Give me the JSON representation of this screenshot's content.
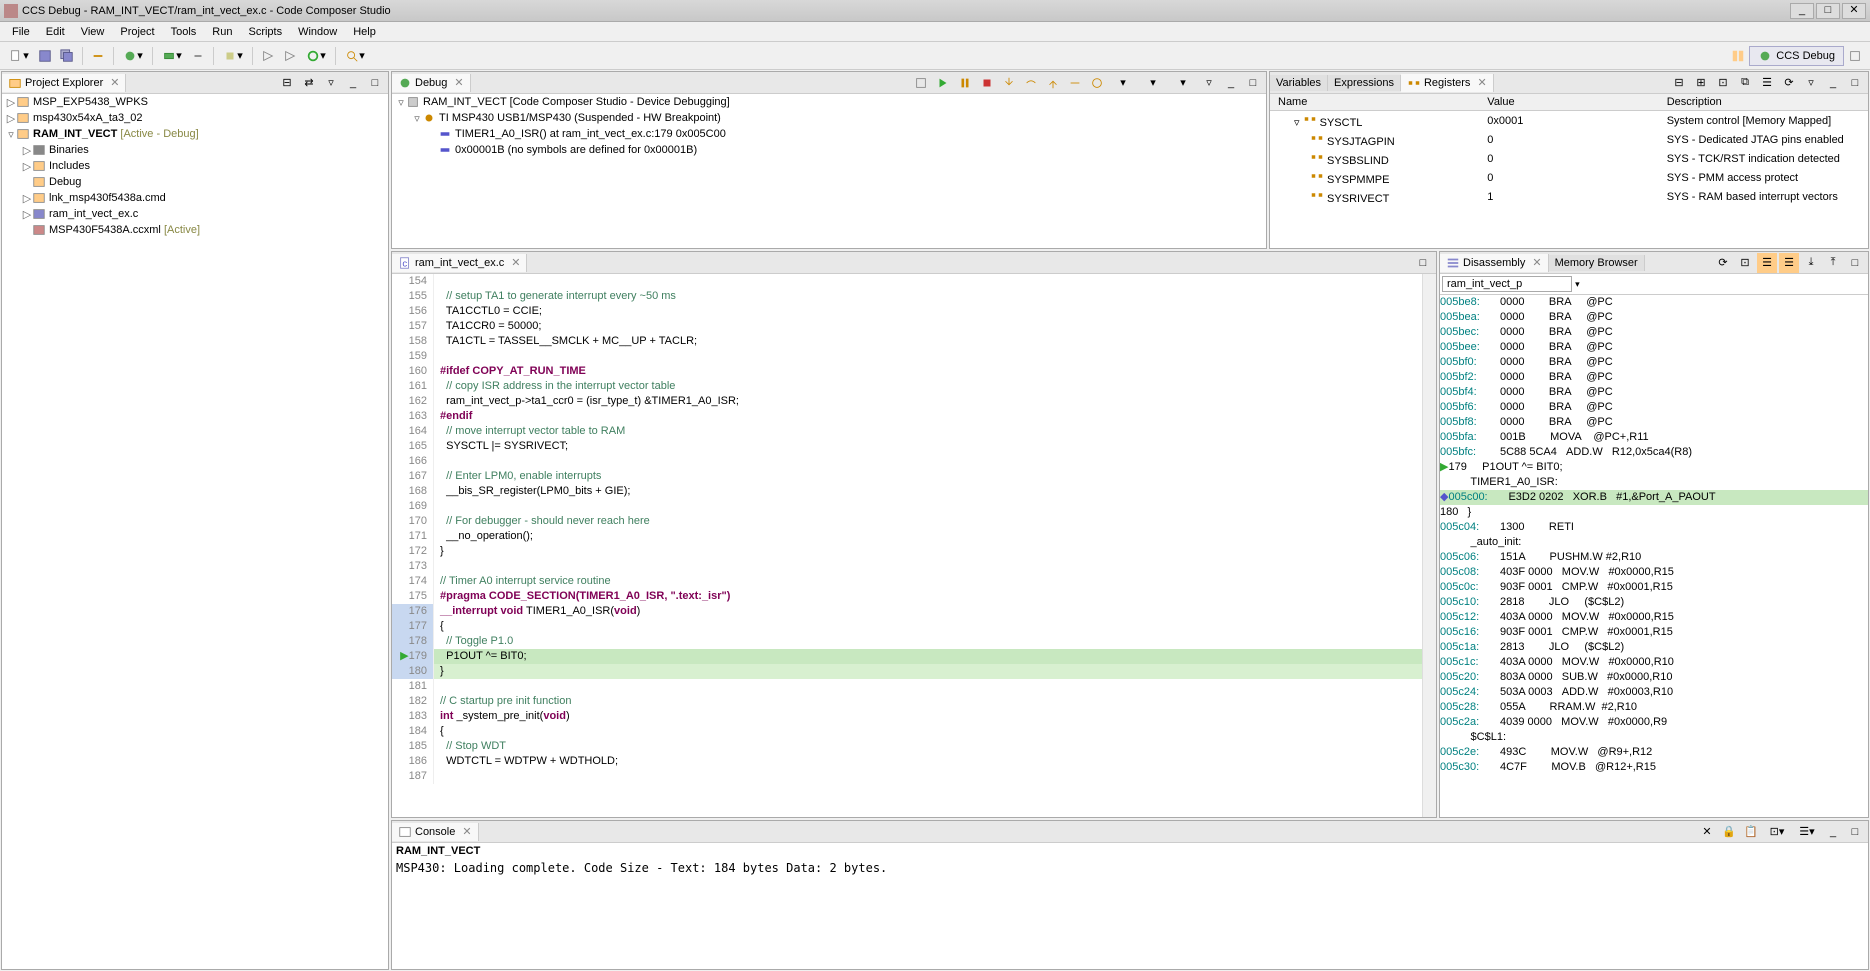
{
  "window_title": "CCS Debug - RAM_INT_VECT/ram_int_vect_ex.c - Code Composer Studio",
  "menu": [
    "File",
    "Edit",
    "View",
    "Project",
    "Tools",
    "Run",
    "Scripts",
    "Window",
    "Help"
  ],
  "perspective": "CCS Debug",
  "project_explorer": {
    "title": "Project Explorer",
    "items": [
      {
        "label": "MSP_EXP5438_WPKS",
        "indent": 0,
        "arrow": "▷",
        "icon": "project"
      },
      {
        "label": "msp430x54xA_ta3_02",
        "indent": 0,
        "arrow": "▷",
        "icon": "project"
      },
      {
        "label": "RAM_INT_VECT",
        "suffix": "[Active - Debug]",
        "indent": 0,
        "arrow": "▿",
        "icon": "project",
        "bold": true
      },
      {
        "label": "Binaries",
        "indent": 1,
        "arrow": "▷",
        "icon": "bin"
      },
      {
        "label": "Includes",
        "indent": 1,
        "arrow": "▷",
        "icon": "inc"
      },
      {
        "label": "Debug",
        "indent": 1,
        "arrow": "",
        "icon": "folder"
      },
      {
        "label": "lnk_msp430f5438a.cmd",
        "indent": 1,
        "arrow": "▷",
        "icon": "file"
      },
      {
        "label": "ram_int_vect_ex.c",
        "indent": 1,
        "arrow": "▷",
        "icon": "cfile"
      },
      {
        "label": "MSP430F5438A.ccxml",
        "suffix": "[Active]",
        "indent": 1,
        "arrow": "",
        "icon": "xml"
      }
    ]
  },
  "debug_view": {
    "title": "Debug",
    "items": [
      {
        "label": "RAM_INT_VECT [Code Composer Studio - Device Debugging]",
        "indent": 0,
        "arrow": "▿",
        "icon": "chip"
      },
      {
        "label": "TI MSP430 USB1/MSP430 (Suspended - HW Breakpoint)",
        "indent": 1,
        "arrow": "▿",
        "icon": "thread"
      },
      {
        "label": "TIMER1_A0_ISR() at ram_int_vect_ex.c:179 0x005C00",
        "indent": 2,
        "arrow": "",
        "icon": "frame"
      },
      {
        "label": "0x00001B (no symbols are defined for 0x00001B)",
        "indent": 2,
        "arrow": "",
        "icon": "frame"
      }
    ]
  },
  "registers_view": {
    "tabs": [
      "Variables",
      "Expressions",
      "Registers"
    ],
    "active_tab": 2,
    "columns": [
      "Name",
      "Value",
      "Description"
    ],
    "rows": [
      {
        "name": "SYSCTL",
        "value": "0x0001",
        "desc": "System control [Memory Mapped]",
        "indent": 1,
        "arrow": "▿"
      },
      {
        "name": "SYSJTAGPIN",
        "value": "0",
        "desc": "SYS - Dedicated JTAG pins enabled",
        "indent": 2
      },
      {
        "name": "SYSBSLIND",
        "value": "0",
        "desc": "SYS - TCK/RST indication detected",
        "indent": 2
      },
      {
        "name": "SYSPMMPE",
        "value": "0",
        "desc": "SYS - PMM access protect",
        "indent": 2
      },
      {
        "name": "SYSRIVECT",
        "value": "1",
        "desc": "SYS - RAM based interrupt vectors",
        "indent": 2
      }
    ]
  },
  "editor": {
    "filename": "ram_int_vect_ex.c",
    "lines": [
      {
        "n": 154,
        "text": ""
      },
      {
        "n": 155,
        "text": "  // setup TA1 to generate interrupt every ~50 ms",
        "cm": true
      },
      {
        "n": 156,
        "text": "  TA1CCTL0 = CCIE;"
      },
      {
        "n": 157,
        "text": "  TA1CCR0 = 50000;"
      },
      {
        "n": 158,
        "text": "  TA1CTL = TASSEL__SMCLK + MC__UP + TACLR;"
      },
      {
        "n": 159,
        "text": ""
      },
      {
        "n": 160,
        "text": "#ifdef COPY_AT_RUN_TIME",
        "kw": true
      },
      {
        "n": 161,
        "text": "  // copy ISR address in the interrupt vector table",
        "cm": true
      },
      {
        "n": 162,
        "text": "  ram_int_vect_p->ta1_ccr0 = (isr_type_t) &TIMER1_A0_ISR;"
      },
      {
        "n": 163,
        "text": "#endif",
        "kw": true
      },
      {
        "n": 164,
        "text": "  // move interrupt vector table to RAM",
        "cm": true
      },
      {
        "n": 165,
        "text": "  SYSCTL |= SYSRIVECT;"
      },
      {
        "n": 166,
        "text": ""
      },
      {
        "n": 167,
        "text": "  // Enter LPM0, enable interrupts",
        "cm": true
      },
      {
        "n": 168,
        "text": "  __bis_SR_register(LPM0_bits + GIE);"
      },
      {
        "n": 169,
        "text": ""
      },
      {
        "n": 170,
        "text": "  // For debugger - should never reach here",
        "cm": true
      },
      {
        "n": 171,
        "text": "  __no_operation();"
      },
      {
        "n": 172,
        "text": "}"
      },
      {
        "n": 173,
        "text": ""
      },
      {
        "n": 174,
        "text": "// Timer A0 interrupt service routine",
        "cm": true
      },
      {
        "n": 175,
        "text": "#pragma CODE_SECTION(TIMER1_A0_ISR, \".text:_isr\")",
        "kw": true
      },
      {
        "n": 176,
        "text": "__interrupt void TIMER1_A0_ISR(void)",
        "blue": true,
        "kw2": true
      },
      {
        "n": 177,
        "text": "{",
        "blue": true
      },
      {
        "n": 178,
        "text": "  // Toggle P1.0",
        "blue": true,
        "cm": true
      },
      {
        "n": 179,
        "text": "  P1OUT ^= BIT0;",
        "blue": true,
        "hl": true
      },
      {
        "n": 180,
        "text": "}",
        "blue": true,
        "hl2": true
      },
      {
        "n": 181,
        "text": ""
      },
      {
        "n": 182,
        "text": "// C startup pre init function",
        "cm": true
      },
      {
        "n": 183,
        "text": "int _system_pre_init(void)",
        "kw2": true
      },
      {
        "n": 184,
        "text": "{"
      },
      {
        "n": 185,
        "text": "  // Stop WDT",
        "cm": true
      },
      {
        "n": 186,
        "text": "  WDTCTL = WDTPW + WDTHOLD;"
      },
      {
        "n": 187,
        "text": ""
      }
    ]
  },
  "disassembly": {
    "title": "Disassembly",
    "other_tab": "Memory Browser",
    "search": "ram_int_vect_p",
    "lines": [
      {
        "addr": "005be8:",
        "hex": "0000",
        "mn": "BRA",
        "op": "@PC"
      },
      {
        "addr": "005bea:",
        "hex": "0000",
        "mn": "BRA",
        "op": "@PC"
      },
      {
        "addr": "005bec:",
        "hex": "0000",
        "mn": "BRA",
        "op": "@PC"
      },
      {
        "addr": "005bee:",
        "hex": "0000",
        "mn": "BRA",
        "op": "@PC"
      },
      {
        "addr": "005bf0:",
        "hex": "0000",
        "mn": "BRA",
        "op": "@PC"
      },
      {
        "addr": "005bf2:",
        "hex": "0000",
        "mn": "BRA",
        "op": "@PC"
      },
      {
        "addr": "005bf4:",
        "hex": "0000",
        "mn": "BRA",
        "op": "@PC"
      },
      {
        "addr": "005bf6:",
        "hex": "0000",
        "mn": "BRA",
        "op": "@PC"
      },
      {
        "addr": "005bf8:",
        "hex": "0000",
        "mn": "BRA",
        "op": "@PC"
      },
      {
        "addr": "005bfa:",
        "hex": "001B",
        "mn": "MOVA",
        "op": "@PC+,R11"
      },
      {
        "addr": "005bfc:",
        "hex": "5C88 5CA4",
        "mn": "ADD.W",
        "op": "R12,0x5ca4(R8)"
      },
      {
        "addr": "",
        "src": "179",
        "text": "     P1OUT ^= BIT0;",
        "marker": true
      },
      {
        "addr": "",
        "label": "          TIMER1_A0_ISR:"
      },
      {
        "addr": "005c00:",
        "hex": "E3D2 0202",
        "mn": "XOR.B",
        "op": "#1,&Port_A_PAOUT",
        "hl": true,
        "marker2": true
      },
      {
        "addr": "",
        "src": "180",
        "text": "   }"
      },
      {
        "addr": "005c04:",
        "hex": "1300",
        "mn": "RETI",
        "op": ""
      },
      {
        "addr": "",
        "label": "          _auto_init:"
      },
      {
        "addr": "005c06:",
        "hex": "151A",
        "mn": "PUSHM.W",
        "op": "#2,R10"
      },
      {
        "addr": "005c08:",
        "hex": "403F 0000",
        "mn": "MOV.W",
        "op": "#0x0000,R15"
      },
      {
        "addr": "005c0c:",
        "hex": "903F 0001",
        "mn": "CMP.W",
        "op": "#0x0001,R15"
      },
      {
        "addr": "005c10:",
        "hex": "2818",
        "mn": "JLO",
        "op": "($C$L2)"
      },
      {
        "addr": "005c12:",
        "hex": "403A 0000",
        "mn": "MOV.W",
        "op": "#0x0000,R15"
      },
      {
        "addr": "005c16:",
        "hex": "903F 0001",
        "mn": "CMP.W",
        "op": "#0x0001,R15"
      },
      {
        "addr": "005c1a:",
        "hex": "2813",
        "mn": "JLO",
        "op": "($C$L2)"
      },
      {
        "addr": "005c1c:",
        "hex": "403A 0000",
        "mn": "MOV.W",
        "op": "#0x0000,R10"
      },
      {
        "addr": "005c20:",
        "hex": "803A 0000",
        "mn": "SUB.W",
        "op": "#0x0000,R10"
      },
      {
        "addr": "005c24:",
        "hex": "503A 0003",
        "mn": "ADD.W",
        "op": "#0x0003,R10"
      },
      {
        "addr": "005c28:",
        "hex": "055A",
        "mn": "RRAM.W",
        "op": "#2,R10"
      },
      {
        "addr": "005c2a:",
        "hex": "4039 0000",
        "mn": "MOV.W",
        "op": "#0x0000,R9"
      },
      {
        "addr": "",
        "label": "          $C$L1:"
      },
      {
        "addr": "005c2e:",
        "hex": "493C",
        "mn": "MOV.W",
        "op": "@R9+,R12"
      },
      {
        "addr": "005c30:",
        "hex": "4C7F",
        "mn": "MOV.B",
        "op": "@R12+,R15"
      }
    ]
  },
  "console": {
    "title": "Console",
    "header": "RAM_INT_VECT",
    "text": "MSP430: Loading complete. Code Size - Text: 184 bytes Data: 2 bytes."
  }
}
